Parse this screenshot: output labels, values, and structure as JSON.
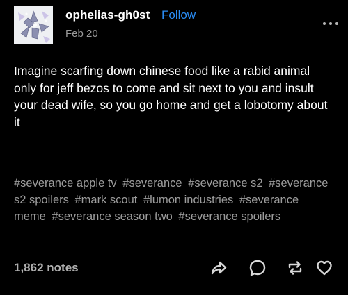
{
  "post": {
    "username": "ophelias-gh0st",
    "follow_label": "Follow",
    "date": "Feb 20",
    "body": "Imagine scarfing down chinese food like a rabid animal only for jeff bezos to come and sit next to you and insult your dead wife, so you go home and get a lobotomy about it",
    "tags": [
      "#severance apple tv",
      "#severance",
      "#severance s2",
      "#severance s2 spoilers",
      "#mark scout",
      "#lumon industries",
      "#severance meme",
      "#severance season two",
      "#severance spoilers"
    ],
    "notes": "1,862 notes"
  },
  "icons": {
    "more": "more-horizontal-icon",
    "share": "share-arrow-icon",
    "reply": "reply-bubble-icon",
    "reblog": "reblog-icon",
    "like": "heart-icon"
  },
  "colors": {
    "background": "#000000",
    "text": "#ffffff",
    "follow_link": "#2a8df5",
    "muted": "#9c9c9c"
  }
}
